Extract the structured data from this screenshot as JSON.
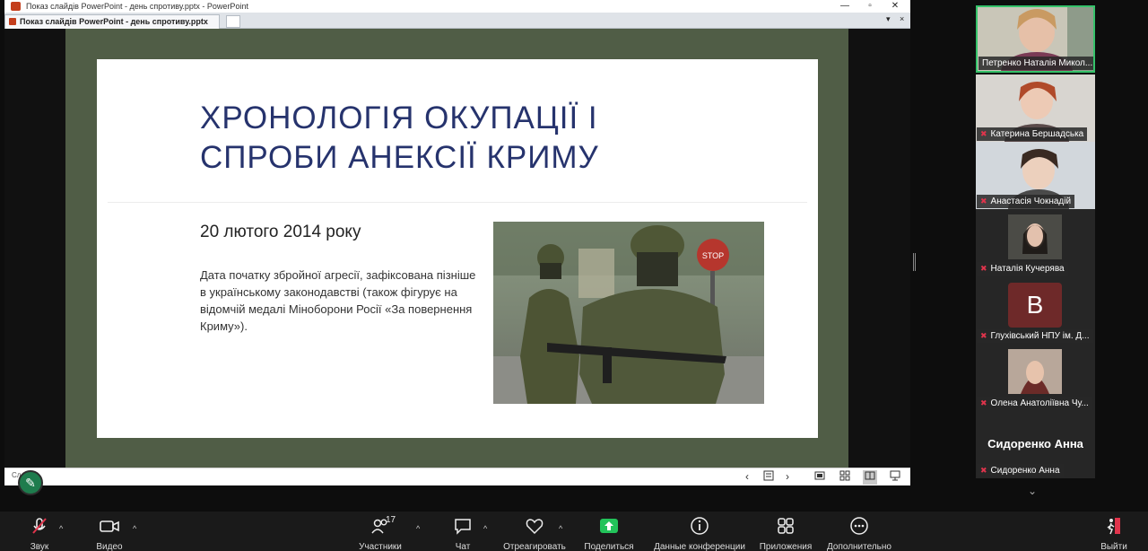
{
  "window": {
    "title": "Показ слайдів PowerPoint  -  день спротиву.pptx  -  PowerPoint",
    "tab_label": "Показ слайдів PowerPoint  -  день спротиву.pptx",
    "minimize": "—",
    "restore": "▫",
    "close": "✕",
    "tab_menu": "▾",
    "tab_close": "×"
  },
  "slide": {
    "title_line1": "ХРОНОЛОГІЯ ОКУПАЦІЇ І",
    "title_line2": "СПРОБИ АНЕКСІЇ КРИМУ",
    "date": "20 лютого 2014 року",
    "body": "Дата початку збройної агресії, зафіксована пізніше в українському законодавстві (також фігурує на відомчій медалі Міноборони Росії «За повернення Криму»).",
    "photo_sign": "STOP"
  },
  "status": {
    "slide_number": "Сл... 29",
    "prev": "‹",
    "next": "›"
  },
  "participants": [
    {
      "name": "Петренко Наталія Микол...",
      "muted": false,
      "active": true
    },
    {
      "name": "Катерина Бершадська",
      "muted": true,
      "active": false
    },
    {
      "name": "Анастасія Чокнадій",
      "muted": true,
      "active": false
    },
    {
      "name": "Наталія Кучерява",
      "muted": true,
      "active": false
    },
    {
      "name": "Глухівський НПУ ім. Д...",
      "muted": true,
      "active": false,
      "avatar_letter": "B"
    },
    {
      "name": "Олена Анатоліївна Чу...",
      "muted": true,
      "active": false
    },
    {
      "name": "Сидоренко Анна",
      "muted": true,
      "active": false
    }
  ],
  "self_view_name": "Сидоренко Анна",
  "toolbar": {
    "sound": "Звук",
    "video": "Видео",
    "participants": "Участники",
    "participants_count": "17",
    "chat": "Чат",
    "react": "Отреагировать",
    "share": "Поделиться",
    "conference_data": "Данные конференции",
    "apps": "Приложения",
    "more": "Дополнительно",
    "leave": "Выйти"
  },
  "colors": {
    "slide_title": "#26336d",
    "stage_bg": "#505d46",
    "active_speaker": "#35c26a",
    "share_green": "#22c35a",
    "pen_button": "#1e7c4d"
  }
}
